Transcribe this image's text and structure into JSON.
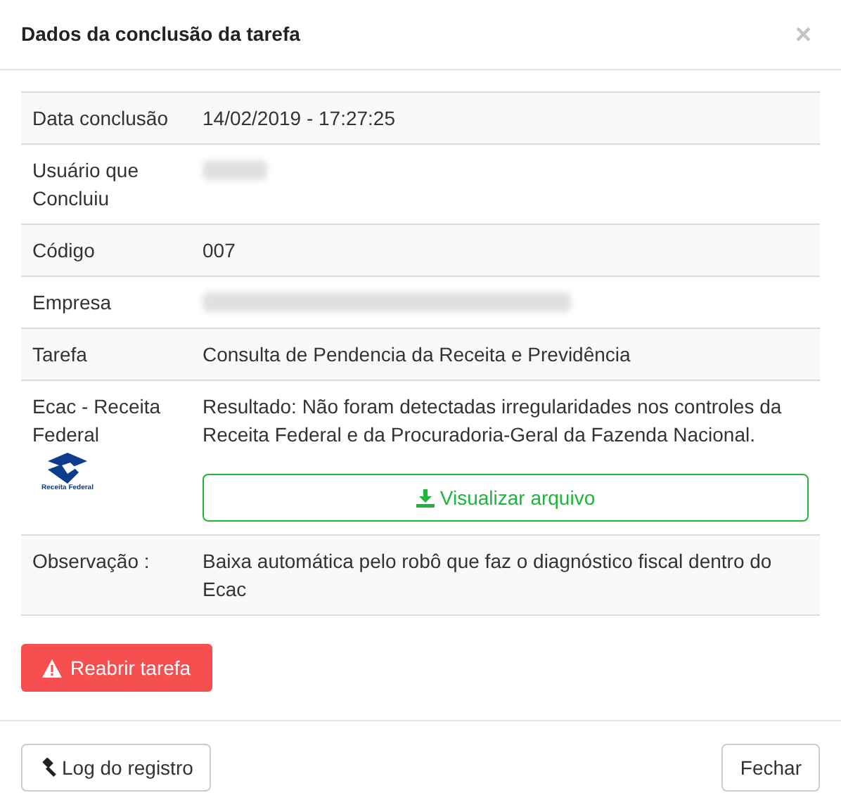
{
  "modal": {
    "title": "Dados da conclusão da tarefa",
    "close": "×"
  },
  "rows": [
    {
      "kind": "text",
      "label": "Data conclusão",
      "value": "14/02/2019 - 17:27:25"
    },
    {
      "kind": "redacted",
      "label": "Usuário que Concluiu"
    },
    {
      "kind": "text",
      "label": "Código",
      "value": "007"
    },
    {
      "kind": "redacted",
      "label": "Empresa"
    },
    {
      "kind": "text",
      "label": "Tarefa",
      "value": "Consulta de Pendencia da Receita e Previdência"
    },
    {
      "kind": "result",
      "label": "Ecac - Receita Federal",
      "logo_text": "Receita Federal",
      "value": "Resultado: Não foram detectadas irregularidades nos controles da Receita Federal e da Procuradoria-Geral da Fazenda Nacional.",
      "button": "Visualizar arquivo"
    },
    {
      "kind": "text",
      "label": "Observação :",
      "value": "Baixa automática pelo robô que faz o diagnóstico fiscal dentro do Ecac"
    }
  ],
  "reopen_button": "Reabrir tarefa",
  "footer": {
    "log_button": "Log do registro",
    "close_button": "Fechar"
  }
}
